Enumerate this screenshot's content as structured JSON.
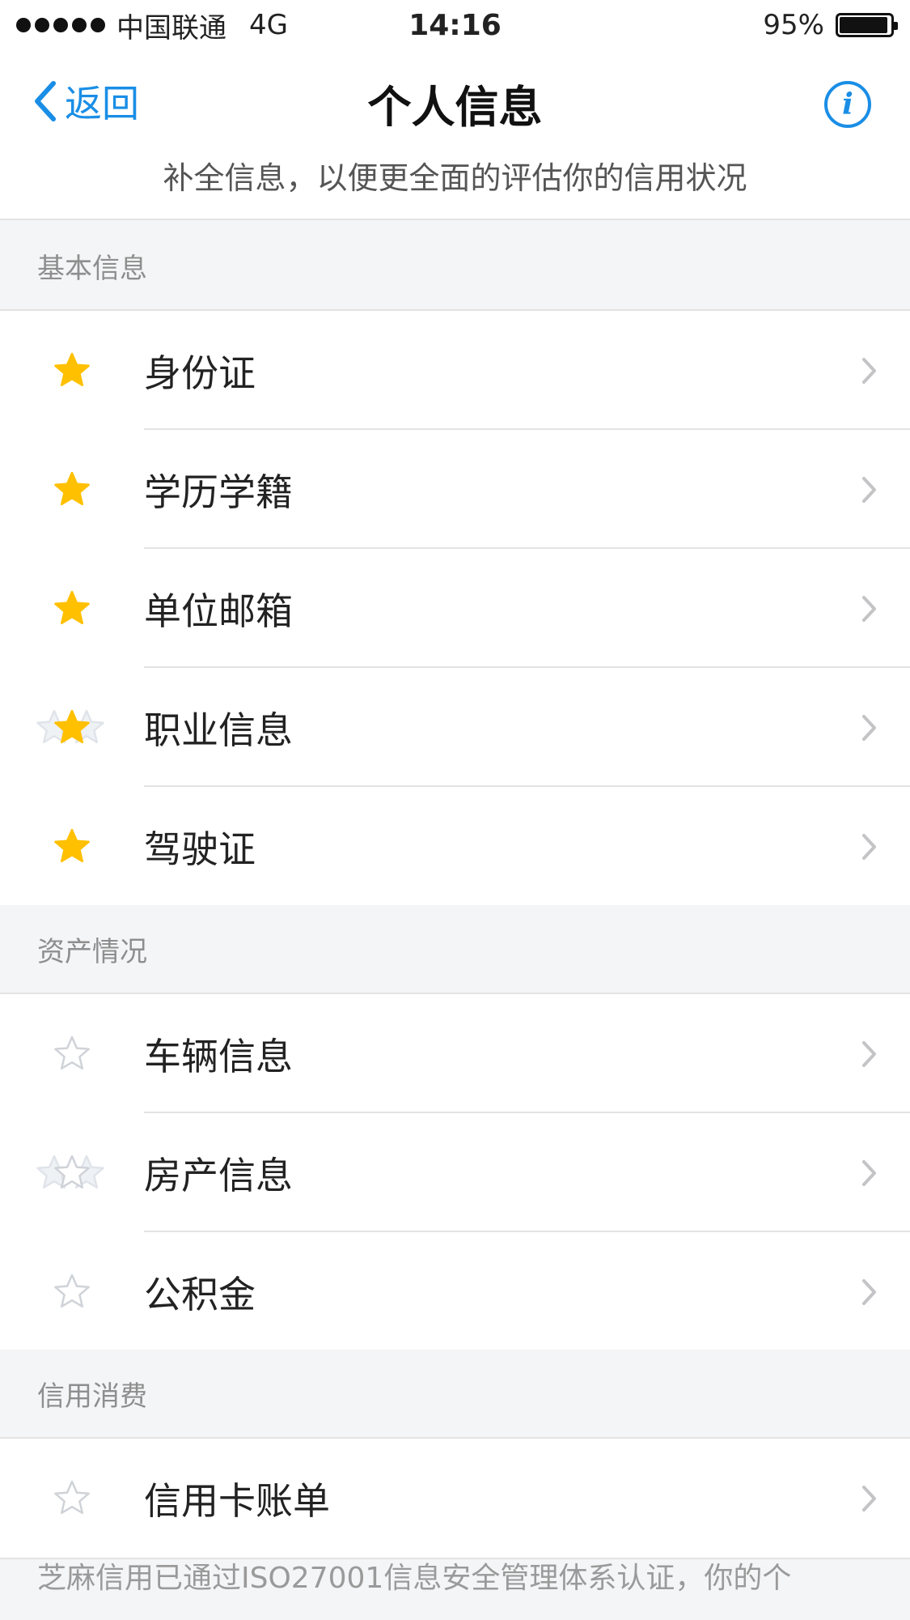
{
  "status": {
    "carrier": "中国联通",
    "network": "4G",
    "time": "14:16",
    "battery_text": "95%",
    "battery_level": 0.95
  },
  "nav": {
    "back_label": "返回",
    "title": "个人信息",
    "info_icon": "info-icon"
  },
  "subtitle": "补全信息，以便更全面的评估你的信用状况",
  "sections": {
    "basic": {
      "title": "基本信息",
      "items": [
        {
          "label": "身份证",
          "star": "filled"
        },
        {
          "label": "学历学籍",
          "star": "filled"
        },
        {
          "label": "单位邮箱",
          "star": "filled"
        },
        {
          "label": "职业信息",
          "star": "filled-multi"
        },
        {
          "label": "驾驶证",
          "star": "filled"
        }
      ]
    },
    "assets": {
      "title": "资产情况",
      "items": [
        {
          "label": "车辆信息",
          "star": "outline"
        },
        {
          "label": "房产信息",
          "star": "outline-multi"
        },
        {
          "label": "公积金",
          "star": "outline"
        }
      ]
    },
    "credit": {
      "title": "信用消费",
      "items": [
        {
          "label": "信用卡账单",
          "star": "outline"
        }
      ]
    }
  },
  "footer": "芝麻信用已通过ISO27001信息安全管理体系认证，你的个",
  "colors": {
    "accent": "#1a8ee6",
    "star_filled": "#ffc000",
    "star_outline": "#cfd3d8"
  }
}
